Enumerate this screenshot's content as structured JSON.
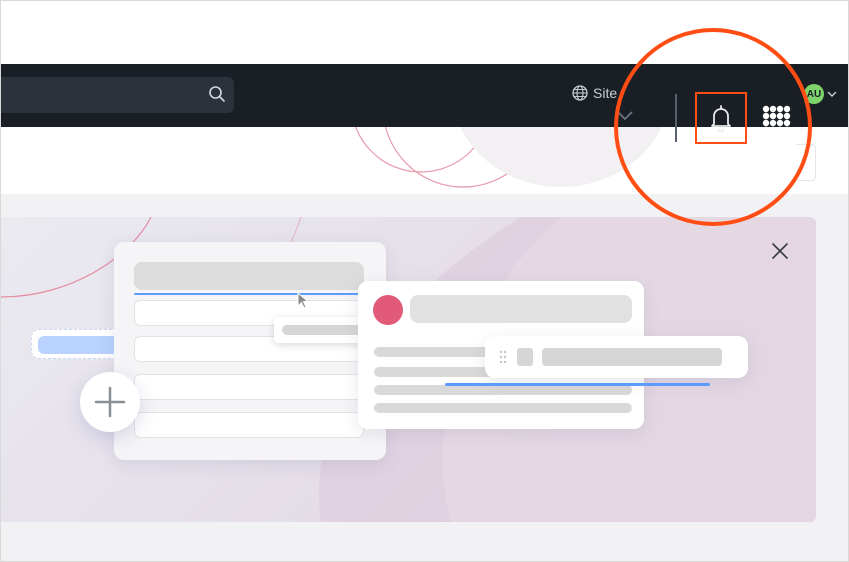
{
  "header": {
    "site_label": "Site",
    "avatar_initials": "AU",
    "icons": {
      "search": "search-icon",
      "site": "globe-icon",
      "bell": "bell-icon",
      "apps": "apps-grid-icon",
      "chevron": "chevron-down-icon"
    }
  },
  "highlight": {
    "target": "notifications-bell",
    "color": "#ff4d14"
  },
  "banner": {
    "close_icon": "close-icon"
  },
  "colors": {
    "topbar": "#1a1f26",
    "accent": "#ff4d14",
    "avatar": "#7ed36b",
    "illustration_blue": "#5c9cff",
    "illustration_pink": "#e15a78"
  }
}
